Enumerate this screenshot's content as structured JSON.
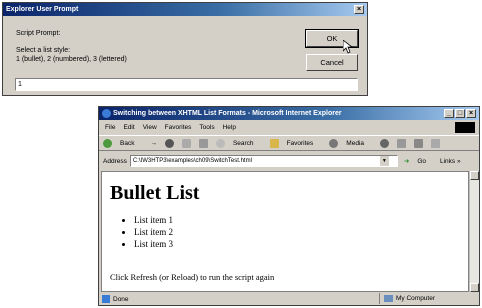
{
  "prompt_dialog": {
    "title": "Explorer User Prompt",
    "close_glyph": "×",
    "script_prompt_label": "Script Prompt:",
    "message_line1": "Select a list style:",
    "message_line2": "1 (bullet), 2 (numbered), 3 (lettered)",
    "ok_label": "OK",
    "cancel_label": "Cancel",
    "input_value": "1"
  },
  "browser": {
    "title": "Switching between XHTML List Formats - Microsoft Internet Explorer",
    "window_controls": [
      "_",
      "□",
      "×"
    ],
    "menu": [
      "File",
      "Edit",
      "View",
      "Favorites",
      "Tools",
      "Help"
    ],
    "toolbar": {
      "back": "Back",
      "forward": "→",
      "search": "Search",
      "favorites": "Favorites",
      "media": "Media"
    },
    "address_label": "Address",
    "address_value": "C:\\IW3HTP3\\examples\\ch09\\SwitchTest.html",
    "go_label": "Go",
    "links_label": "Links »",
    "page": {
      "heading": "Bullet List",
      "items": [
        "List item 1",
        "List item 2",
        "List item 3"
      ],
      "footer": "Click Refresh (or Reload) to run the script again"
    },
    "status_text": "Done",
    "status_zone": "My Computer"
  }
}
